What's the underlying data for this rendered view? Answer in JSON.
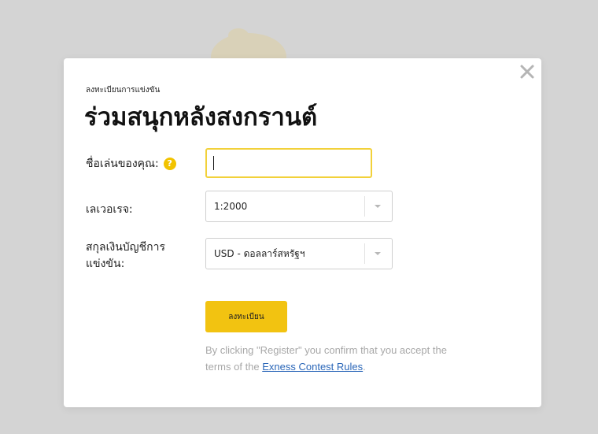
{
  "modal": {
    "subtitle": "ลงทะเบียนการแข่งขัน",
    "title": "ร่วมสนุกหลังสงกรานต์",
    "close_icon": "close-icon"
  },
  "form": {
    "nickname": {
      "label": "ชื่อเล่นของคุณ:",
      "value": "",
      "help_glyph": "?"
    },
    "leverage": {
      "label": "เลเวอเรจ:",
      "selected": "1:2000"
    },
    "currency": {
      "label": "สกุลเงินบัญชีการแข่งขัน:",
      "selected": "USD - ดอลลาร์สหรัฐฯ"
    },
    "register_label": "ลงทะเบียน"
  },
  "terms": {
    "prefix": "By clicking \"Register\" you confirm that you accept the terms of the ",
    "link_text": "Exness Contest Rules",
    "suffix": "."
  },
  "colors": {
    "accent": "#f2c311",
    "link": "#2a66b8",
    "input_focus_border": "#f2d13a"
  }
}
